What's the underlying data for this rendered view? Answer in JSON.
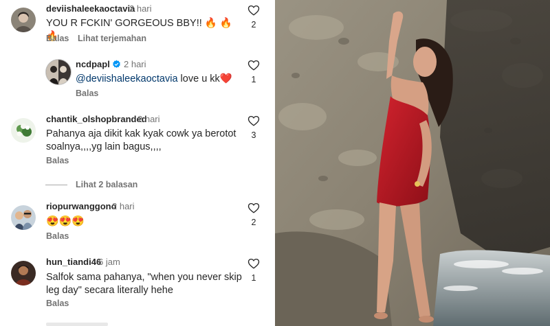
{
  "comments": [
    {
      "username": "deviishaleekaoctavia",
      "time": "2 hari",
      "text": "YOU R FCKIN' GORGEOUS BBY!! 🔥 🔥 🔥",
      "reply": "Balas",
      "translate": "Lihat terjemahan",
      "likes": "2"
    },
    {
      "username": "ncdpapl",
      "time": "2 hari",
      "mention": "@deviishaleekaoctavia",
      "text_rest": " love u kk❤️",
      "reply": "Balas",
      "likes": "1"
    },
    {
      "username": "chantik_olshopbranded",
      "time": "2 hari",
      "text": "Pahanya aja dikit kak kyak cowk ya berotot soalnya,,,,yg lain bagus,,,,",
      "reply": "Balas",
      "likes": "3"
    },
    {
      "username": "riopurwanggono",
      "time": "2 hari",
      "text": "😍😍😍",
      "reply": "Balas",
      "likes": "2"
    },
    {
      "username": "hun_tiandi46",
      "time": "6 jam",
      "text": "Salfok sama pahanya, \"when you never skip leg day\" secara literally hehe",
      "reply": "Balas",
      "likes": "1"
    }
  ],
  "view_replies": "Lihat 2 balasan",
  "icons": {
    "like": "heart-outline-icon",
    "verified": "verified-badge-icon"
  },
  "colors": {
    "verified": "#0095f6",
    "mention": "#00376b",
    "secondary": "#737373"
  }
}
